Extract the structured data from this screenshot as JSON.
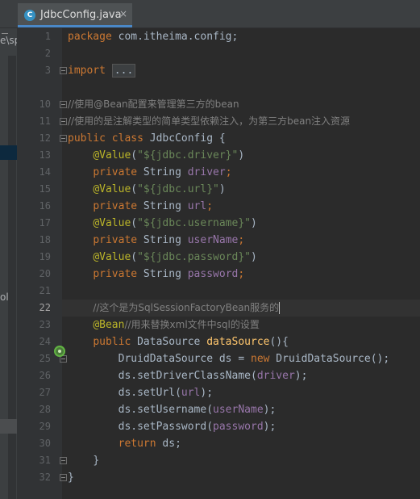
{
  "tab": {
    "filename": "JdbcConfig.java",
    "close": "×",
    "icon_letter": "C"
  },
  "left_panel": {
    "crumb": "e\\sp",
    "side_label": "ol"
  },
  "gutter": {
    "line_numbers": [
      "1",
      "2",
      "3",
      "10",
      "11",
      "12",
      "13",
      "14",
      "15",
      "16",
      "17",
      "18",
      "19",
      "20",
      "21",
      "22",
      "23",
      "24",
      "25",
      "26",
      "27",
      "28",
      "29",
      "30",
      "31",
      "32"
    ],
    "current_line": "22"
  },
  "code": {
    "package_kw": "package",
    "package_name": " com.itheima.config;",
    "import_kw": "import",
    "import_folded": "...",
    "comment1": "//使用@Bean配置来管理第三方的bean",
    "comment2": "//使用的是注解类型的简单类型依赖注入，为第三方bean注入资源",
    "class_decl_kw": "public class",
    "class_name": " JdbcConfig {",
    "value_annotation": "@Value",
    "open_paren": "(",
    "close_paren": ")",
    "private_kw": "private",
    "string_type": " String ",
    "semicolon": ";",
    "fields": [
      {
        "value_string": "\"${jdbc.driver}\"",
        "name": "driver"
      },
      {
        "value_string": "\"${jdbc.url}\"",
        "name": "url"
      },
      {
        "value_string": "\"${jdbc.username}\"",
        "name": "userName"
      },
      {
        "value_string": "\"${jdbc.password}\"",
        "name": "password"
      }
    ],
    "comment3": "//这个是为SqlSessionFactoryBean服务的",
    "bean_annotation": "@Bean",
    "comment4": "//用来替换xml文件中sql的设置",
    "method_public": "public",
    "method_return": " DataSource ",
    "method_name": "dataSource",
    "method_tail": "(){",
    "stmt_new_lhs": "DruidDataSource ds = ",
    "new_kw": "new",
    "stmt_new_rhs": " DruidDataSource();",
    "calls": [
      {
        "method": "ds.setDriverClassName(",
        "arg": "driver",
        "end": ");"
      },
      {
        "method": "ds.setUrl(",
        "arg": "url",
        "end": ");"
      },
      {
        "method": "ds.setUsername(",
        "arg": "userName",
        "end": ");"
      },
      {
        "method": "ds.setPassword(",
        "arg": "password",
        "end": ");"
      }
    ],
    "return_kw": "return",
    "return_rest": " ds;",
    "close_brace": "}"
  }
}
